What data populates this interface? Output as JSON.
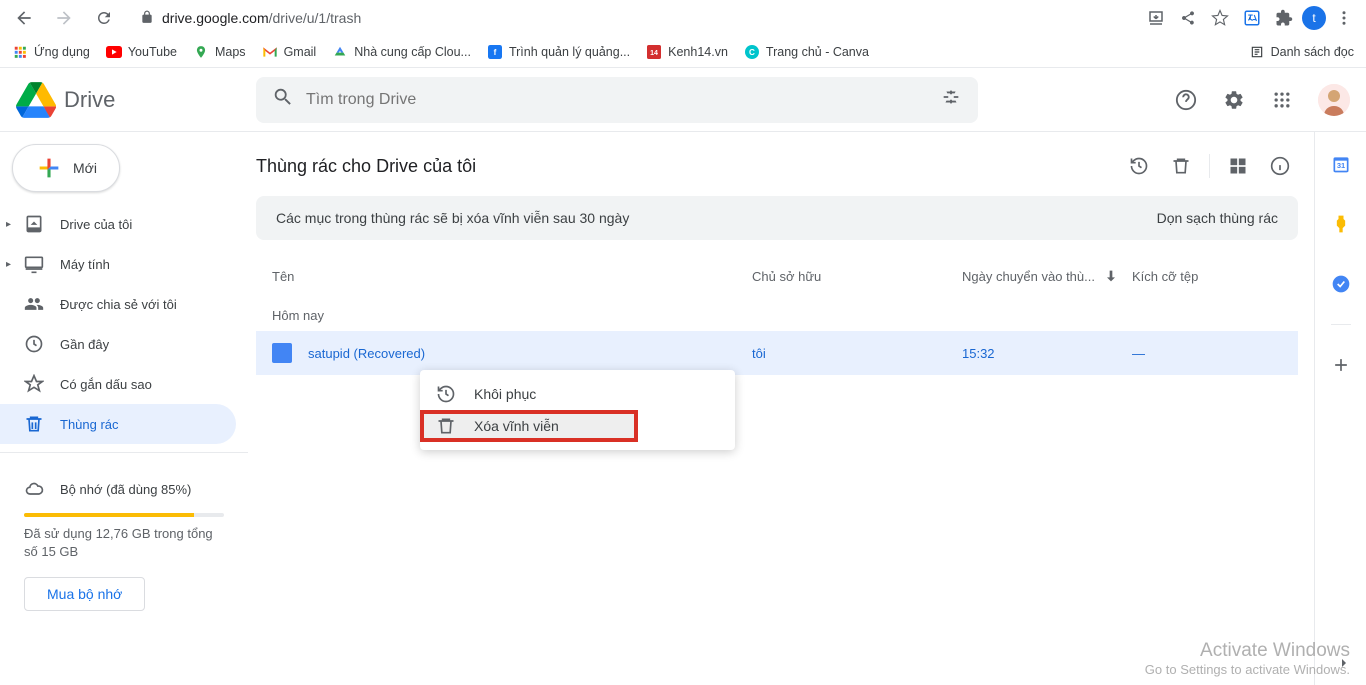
{
  "browser": {
    "url_domain": "drive.google.com",
    "url_path": "/drive/u/1/trash",
    "avatar_letter": "t"
  },
  "bookmarks": {
    "apps": "Ứng dụng",
    "youtube": "YouTube",
    "maps": "Maps",
    "gmail": "Gmail",
    "cloud": "Nhà cung cấp Clou...",
    "ads": "Trình quản lý quảng...",
    "kenh14": "Kenh14.vn",
    "canva": "Trang chủ - Canva",
    "reading": "Danh sách đọc"
  },
  "drive": {
    "logo_text": "Drive",
    "search_placeholder": "Tìm trong Drive"
  },
  "sidebar": {
    "new_btn": "Mới",
    "my_drive": "Drive của tôi",
    "computers": "Máy tính",
    "shared": "Được chia sẻ với tôi",
    "recent": "Gần đây",
    "starred": "Có gắn dấu sao",
    "trash": "Thùng rác",
    "storage": "Bộ nhớ (đã dùng 85%)",
    "storage_text": "Đã sử dụng 12,76 GB trong tổng số 15 GB",
    "buy": "Mua bộ nhớ"
  },
  "content": {
    "title": "Thùng rác cho Drive của tôi",
    "banner_text": "Các mục trong thùng rác sẽ bị xóa vĩnh viễn sau 30 ngày",
    "banner_action": "Dọn sạch thùng rác",
    "col_name": "Tên",
    "col_owner": "Chủ sở hữu",
    "col_date": "Ngày chuyển vào thù...",
    "col_size": "Kích cỡ tệp",
    "section_today": "Hôm nay"
  },
  "file": {
    "name": "satupid (Recovered)",
    "owner": "tôi",
    "date": "15:32",
    "size": "—"
  },
  "menu": {
    "restore": "Khôi phục",
    "delete_forever": "Xóa vĩnh viễn"
  },
  "activate": {
    "title": "Activate Windows",
    "sub": "Go to Settings to activate Windows."
  }
}
